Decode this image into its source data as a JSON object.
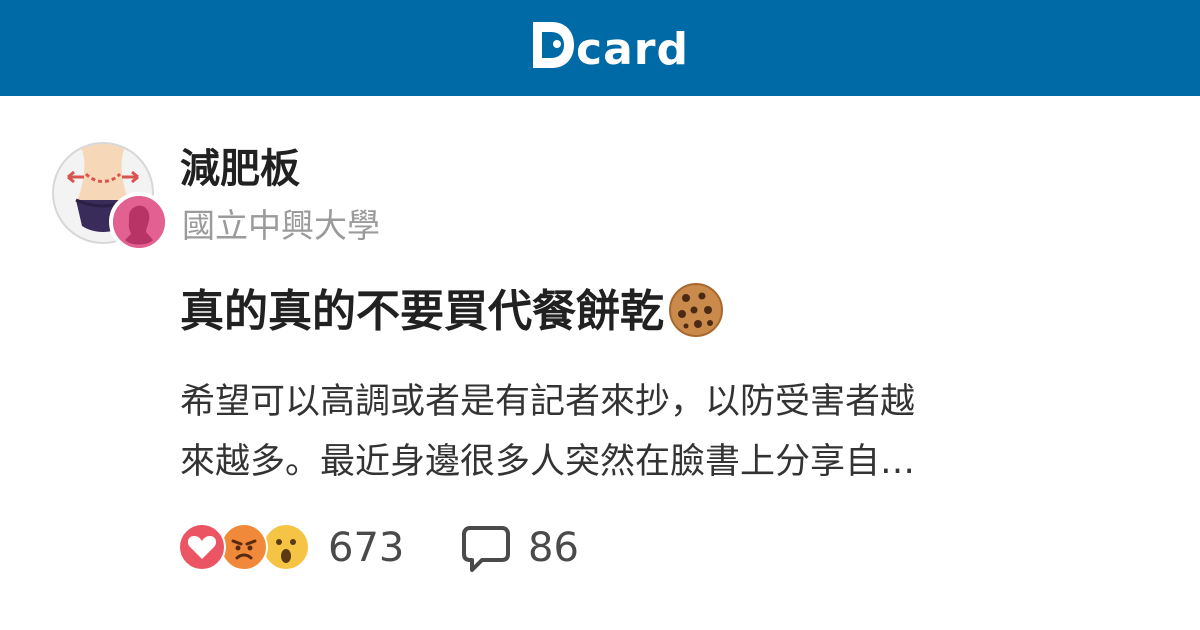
{
  "header": {
    "logo_text": "card",
    "brand_color": "#006aa6"
  },
  "forum": {
    "name": "減肥板",
    "school": "國立中興大學",
    "avatar_icon": "waist-measure-icon",
    "badge_icon": "female-profile-icon"
  },
  "post": {
    "title": "真的真的不要買代餐餅乾",
    "title_emoji": "cookie-emoji-icon",
    "excerpt_lines": [
      "希望可以高調或者是有記者來抄，以防受害者越",
      "來越多。最近身邊很多人突然在臉書上分享自…"
    ]
  },
  "stats": {
    "reactions": [
      "heart-icon",
      "angry-face-icon",
      "surprised-face-icon"
    ],
    "reaction_count": "673",
    "comment_icon": "comment-bubble-icon",
    "comment_count": "86"
  }
}
